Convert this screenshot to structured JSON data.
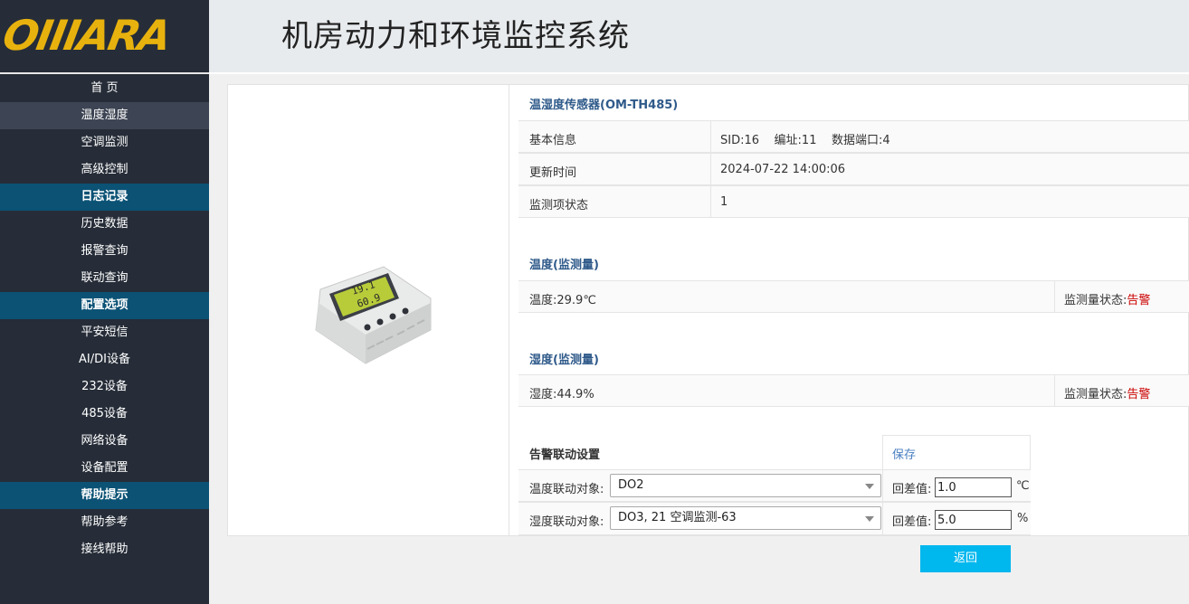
{
  "brand": {
    "logo_text": "OIIIARA"
  },
  "header": {
    "title": "机房动力和环境监控系统"
  },
  "sidebar": {
    "items": [
      {
        "label": "首 页"
      },
      {
        "label": "温度湿度"
      },
      {
        "label": "空调监测"
      },
      {
        "label": "高级控制"
      },
      {
        "label": "日志记录"
      },
      {
        "label": "历史数据"
      },
      {
        "label": "报警查询"
      },
      {
        "label": "联动查询"
      },
      {
        "label": "配置选项"
      },
      {
        "label": "平安短信"
      },
      {
        "label": "AI/DI设备"
      },
      {
        "label": "232设备"
      },
      {
        "label": "485设备"
      },
      {
        "label": "网络设备"
      },
      {
        "label": "设备配置"
      },
      {
        "label": "帮助提示"
      },
      {
        "label": "帮助参考"
      },
      {
        "label": "接线帮助"
      }
    ]
  },
  "device": {
    "title": "温湿度传感器(OM-TH485)",
    "screen_line1": "19.1",
    "screen_line2": "60.9",
    "basic_info_label": "基本信息",
    "basic_info_value": "SID:16    编址:11    数据端口:4",
    "update_time_label": "更新时间",
    "update_time_value": "2024-07-22 14:00:06",
    "status_label": "监测项状态",
    "status_value": "1"
  },
  "temperature": {
    "title": "温度(监测量)",
    "reading": "温度:29.9℃",
    "state_label": "监测量状态:",
    "state_value": "告警"
  },
  "humidity": {
    "title": "湿度(监测量)",
    "reading": "湿度:44.9%",
    "state_label": "监测量状态:",
    "state_value": "告警"
  },
  "linkage": {
    "title": "告警联动设置",
    "save_label": "保存",
    "temp_target_label": "温度联动对象:",
    "temp_target_value": "DO2",
    "temp_hyst_label": "回差值:",
    "temp_hyst_value": "1.0",
    "temp_unit": "℃",
    "hum_target_label": "湿度联动对象:",
    "hum_target_value": "DO3, 21 空调监测-63",
    "hum_hyst_label": "回差值:",
    "hum_hyst_value": "5.0",
    "hum_unit": "%"
  },
  "actions": {
    "back_label": "返回"
  },
  "colors": {
    "accent": "#00b7ee",
    "section_bg": "#0b5275",
    "sidebar_bg": "#262d38",
    "alarm": "#cc0000",
    "logo": "#e8b20e"
  }
}
